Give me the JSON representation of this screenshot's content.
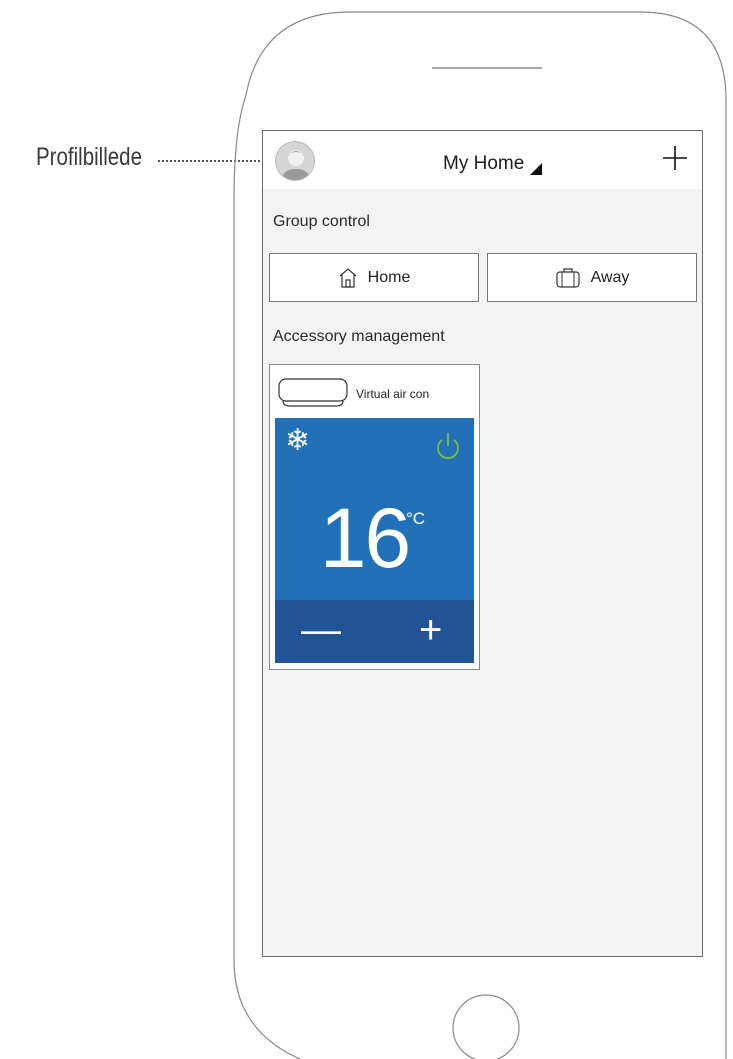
{
  "callout": {
    "label": "Profilbillede"
  },
  "header": {
    "home_name": "My Home",
    "add_icon": "plus-icon"
  },
  "group_control": {
    "title": "Group control",
    "buttons": [
      {
        "label": "Home",
        "icon": "house-icon"
      },
      {
        "label": "Away",
        "icon": "suitcase-icon"
      }
    ]
  },
  "accessory_management": {
    "title": "Accessory management",
    "devices": [
      {
        "name": "Virtual air con",
        "mode_icon": "snowflake-icon",
        "mode_symbol": "❄",
        "temperature": "16",
        "unit": "°C",
        "power_color": "#7ac142",
        "decrease": "—",
        "increase": "+"
      }
    ]
  },
  "colors": {
    "panel_blue": "#2271b8",
    "controls_blue": "#225395",
    "power_green": "#7ac142",
    "screen_bg": "#f3f3f3"
  }
}
